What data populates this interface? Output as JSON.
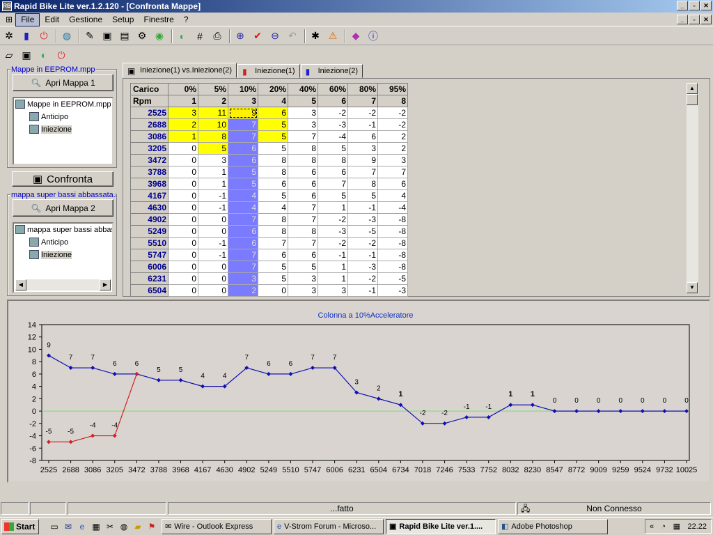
{
  "window": {
    "title": "Rapid Bike Lite ver.1.2.120 - [Confronta Mappe]"
  },
  "menu": [
    "File",
    "Edit",
    "Gestione",
    "Setup",
    "Finestre",
    "?"
  ],
  "left": {
    "group1_label": "Mappe in EEPROM.mpp",
    "open1_label": "Apri Mappa 1",
    "tree1": {
      "root": "Mappe in EEPROM.mpp",
      "children": [
        "Anticipo",
        "Iniezione"
      ]
    },
    "compare_label": "Confronta",
    "group2_label": "mappa super bassi abbassata.m",
    "open2_label": "Apri Mappa 2",
    "tree2": {
      "root": "mappa super bassi abbas",
      "children": [
        "Anticipo",
        "Iniezione"
      ]
    }
  },
  "tabs": [
    "Iniezione(1) vs.Iniezione(2)",
    "Iniezione(1)",
    "Iniezione(2)"
  ],
  "grid": {
    "corner1": "Carico",
    "corner2": "Rpm",
    "load": [
      "0%",
      "5%",
      "10%",
      "20%",
      "40%",
      "60%",
      "80%",
      "95%"
    ],
    "index": [
      "1",
      "2",
      "3",
      "4",
      "5",
      "6",
      "7",
      "8"
    ],
    "rows": [
      {
        "rpm": "2525",
        "v": [
          "3",
          "11",
          "9",
          "6",
          "3",
          "-2",
          "-2",
          "-2"
        ]
      },
      {
        "rpm": "2688",
        "v": [
          "2",
          "10",
          "7",
          "5",
          "3",
          "-3",
          "-1",
          "-2"
        ]
      },
      {
        "rpm": "3086",
        "v": [
          "1",
          "8",
          "7",
          "5",
          "7",
          "-4",
          "6",
          "2"
        ]
      },
      {
        "rpm": "3205",
        "v": [
          "0",
          "5",
          "6",
          "5",
          "8",
          "5",
          "3",
          "2"
        ]
      },
      {
        "rpm": "3472",
        "v": [
          "0",
          "3",
          "6",
          "8",
          "8",
          "8",
          "9",
          "3"
        ]
      },
      {
        "rpm": "3788",
        "v": [
          "0",
          "1",
          "5",
          "8",
          "6",
          "6",
          "7",
          "7"
        ]
      },
      {
        "rpm": "3968",
        "v": [
          "0",
          "1",
          "5",
          "6",
          "6",
          "7",
          "8",
          "6"
        ]
      },
      {
        "rpm": "4167",
        "v": [
          "0",
          "-1",
          "4",
          "5",
          "6",
          "5",
          "5",
          "4"
        ]
      },
      {
        "rpm": "4630",
        "v": [
          "0",
          "-1",
          "4",
          "4",
          "7",
          "1",
          "-1",
          "-4"
        ]
      },
      {
        "rpm": "4902",
        "v": [
          "0",
          "0",
          "7",
          "8",
          "7",
          "-2",
          "-3",
          "-8"
        ]
      },
      {
        "rpm": "5249",
        "v": [
          "0",
          "0",
          "6",
          "8",
          "8",
          "-3",
          "-5",
          "-8"
        ]
      },
      {
        "rpm": "5510",
        "v": [
          "0",
          "-1",
          "6",
          "7",
          "7",
          "-2",
          "-2",
          "-8"
        ]
      },
      {
        "rpm": "5747",
        "v": [
          "0",
          "-1",
          "7",
          "6",
          "6",
          "-1",
          "-1",
          "-8"
        ]
      },
      {
        "rpm": "6006",
        "v": [
          "0",
          "0",
          "7",
          "5",
          "5",
          "1",
          "-3",
          "-8"
        ]
      },
      {
        "rpm": "6231",
        "v": [
          "0",
          "0",
          "3",
          "5",
          "3",
          "1",
          "-2",
          "-5"
        ]
      },
      {
        "rpm": "6504",
        "v": [
          "0",
          "0",
          "2",
          "0",
          "3",
          "3",
          "-1",
          "-3"
        ]
      }
    ]
  },
  "chart_data": {
    "type": "line",
    "title": "Colonna a 10%Acceleratore",
    "categories": [
      "2525",
      "2688",
      "3086",
      "3205",
      "3472",
      "3788",
      "3968",
      "4167",
      "4630",
      "4902",
      "5249",
      "5510",
      "5747",
      "6006",
      "6231",
      "6504",
      "6734",
      "7018",
      "7246",
      "7533",
      "7752",
      "8032",
      "8230",
      "8547",
      "8772",
      "9009",
      "9259",
      "9524",
      "9732",
      "10025"
    ],
    "ylim": [
      -8,
      14
    ],
    "yticks": [
      -8,
      -6,
      -4,
      -2,
      0,
      2,
      4,
      6,
      8,
      10,
      12,
      14
    ],
    "series": [
      {
        "values": [
          9,
          7,
          7,
          6,
          6,
          5,
          5,
          4,
          4,
          7,
          6,
          6,
          7,
          7,
          3,
          2,
          1,
          -2,
          -2,
          -1,
          -1,
          1,
          1,
          0,
          0,
          0,
          0,
          0,
          0,
          0
        ],
        "color": "#1010b0"
      },
      {
        "values": [
          -5,
          -5,
          -4,
          -4,
          6
        ],
        "color": "#d02020"
      }
    ],
    "zero_line_color": "#70e070"
  },
  "status": {
    "msg": "...fatto",
    "conn": "Non Connesso"
  },
  "taskbar": {
    "start": "Start",
    "tasks": [
      "Wire - Outlook Express",
      "V-Strom Forum - Microso...",
      "Rapid Bike Lite ver.1....",
      "Adobe Photoshop"
    ],
    "clock": "22.22",
    "tray_arrows": "«"
  }
}
